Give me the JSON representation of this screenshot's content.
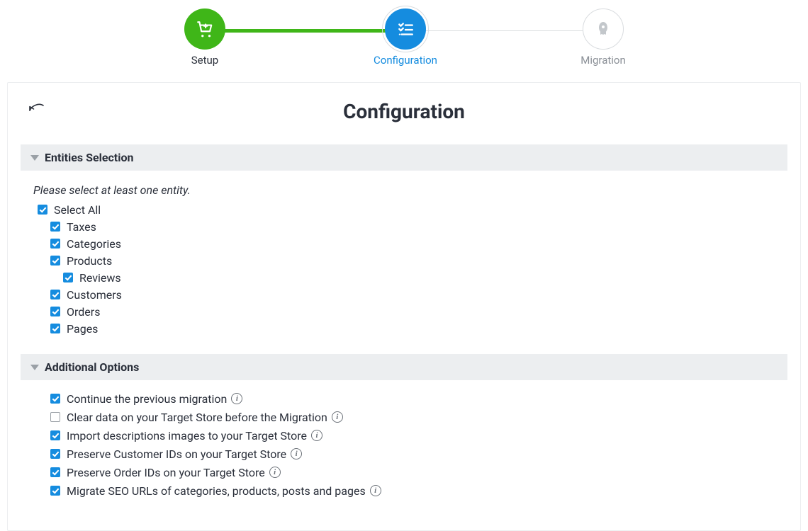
{
  "colors": {
    "accent": "#158cdf",
    "success": "#3fb618"
  },
  "stepper": {
    "steps": [
      {
        "label": "Setup",
        "state": "done"
      },
      {
        "label": "Configuration",
        "state": "active"
      },
      {
        "label": "Migration",
        "state": "pending"
      }
    ]
  },
  "page": {
    "title": "Configuration"
  },
  "sections": {
    "entities": {
      "title": "Entities Selection",
      "hint": "Please select at least one entity.",
      "select_all_label": "Select All",
      "select_all_checked": true,
      "items": [
        {
          "label": "Taxes",
          "checked": true
        },
        {
          "label": "Categories",
          "checked": true
        },
        {
          "label": "Products",
          "checked": true,
          "children": [
            {
              "label": "Reviews",
              "checked": true
            }
          ]
        },
        {
          "label": "Customers",
          "checked": true
        },
        {
          "label": "Orders",
          "checked": true
        },
        {
          "label": "Pages",
          "checked": true
        }
      ]
    },
    "options": {
      "title": "Additional Options",
      "items": [
        {
          "label": "Continue the previous migration",
          "checked": true,
          "info": true
        },
        {
          "label": "Clear data on your Target Store before the Migration",
          "checked": false,
          "info": true
        },
        {
          "label": "Import descriptions images to your Target Store",
          "checked": true,
          "info": true
        },
        {
          "label": "Preserve Customer IDs on your Target Store",
          "checked": true,
          "info": true
        },
        {
          "label": "Preserve Order IDs on your Target Store",
          "checked": true,
          "info": true
        },
        {
          "label": "Migrate SEO URLs of categories, products, posts and pages",
          "checked": true,
          "info": true
        }
      ]
    }
  }
}
